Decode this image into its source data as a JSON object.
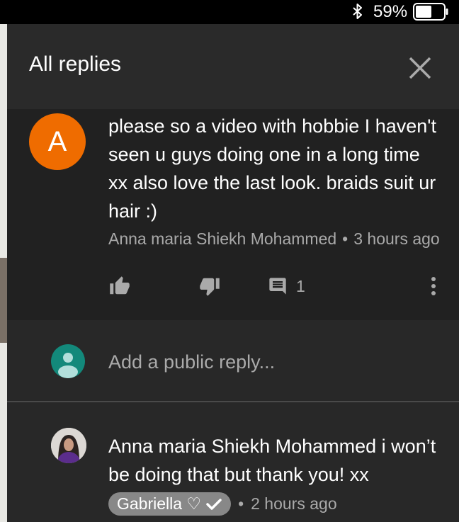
{
  "status_bar": {
    "battery_percent": "59%",
    "battery_level": 0.59
  },
  "header": {
    "title": "All replies"
  },
  "parent_comment": {
    "avatar_letter": "A",
    "avatar_color": "#ef6c00",
    "text": "please so a video with hobbie I haven't seen u guys doing one in a long time xx also love the last look. braids suit ur hair :)",
    "author": "Anna maria Shiekh Mohammed",
    "separator": "•",
    "time": "3 hours ago",
    "reply_count": "1"
  },
  "add_reply": {
    "placeholder": "Add a public reply...",
    "avatar_color": "#13897b"
  },
  "reply": {
    "text": "Anna maria Shiekh Mohammed i won’t be doing that but thank you! xx",
    "author": "Gabriella ♡",
    "separator": "•",
    "time": "2 hours ago"
  },
  "colors": {
    "panel": "#282828",
    "comment_bg": "#212121",
    "secondary_text": "#aaaaaa",
    "author_chip": "#888888"
  },
  "icons": [
    "bluetooth-icon",
    "battery-icon",
    "close-icon",
    "thumb-up-icon",
    "thumb-down-icon",
    "reply-comment-icon",
    "more-vert-icon",
    "verified-check-icon"
  ]
}
